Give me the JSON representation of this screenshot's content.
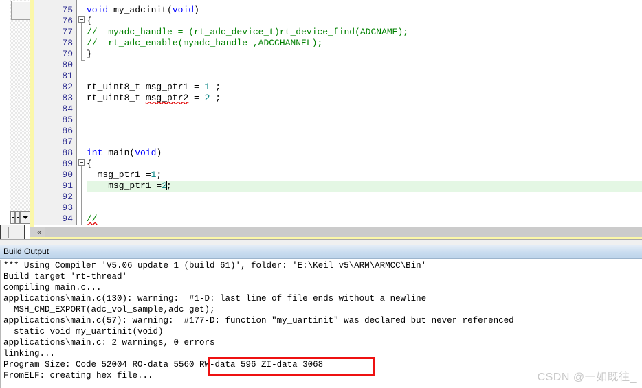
{
  "editor": {
    "scrollbar": {
      "vertical_thumb": "scroll-thumb",
      "up_dot": "·",
      "mid_dot": "·",
      "down_arrow": "▼",
      "h_left_arrow": "«"
    },
    "lines": [
      {
        "num": "75",
        "segments": [
          {
            "t": "void ",
            "c": "kw"
          },
          {
            "t": "my_adcinit(",
            "c": "plain"
          },
          {
            "t": "void",
            "c": "kw"
          },
          {
            "t": ")",
            "c": "plain"
          }
        ]
      },
      {
        "num": "76",
        "segments": [
          {
            "t": "{",
            "c": "plain"
          }
        ]
      },
      {
        "num": "77",
        "segments": [
          {
            "t": "//  myadc_handle = (rt_adc_device_t)rt_device_find(ADCNAME);",
            "c": "cmt"
          }
        ]
      },
      {
        "num": "78",
        "segments": [
          {
            "t": "//  rt_adc_enable(myadc_handle ,ADCCHANNEL);",
            "c": "cmt"
          }
        ]
      },
      {
        "num": "79",
        "segments": [
          {
            "t": "}",
            "c": "plain"
          }
        ]
      },
      {
        "num": "80",
        "segments": []
      },
      {
        "num": "81",
        "segments": []
      },
      {
        "num": "82",
        "segments": [
          {
            "t": "rt_uint8_t msg_ptr1 = ",
            "c": "plain"
          },
          {
            "t": "1",
            "c": "num"
          },
          {
            "t": " ;",
            "c": "plain"
          }
        ]
      },
      {
        "num": "83",
        "segments": [
          {
            "t": "rt_uint8_t ",
            "c": "plain"
          },
          {
            "t": "msg_ptr2",
            "c": "plain squig"
          },
          {
            "t": " = ",
            "c": "plain"
          },
          {
            "t": "2",
            "c": "num"
          },
          {
            "t": " ;",
            "c": "plain"
          }
        ]
      },
      {
        "num": "84",
        "segments": []
      },
      {
        "num": "85",
        "segments": []
      },
      {
        "num": "86",
        "segments": []
      },
      {
        "num": "87",
        "segments": []
      },
      {
        "num": "88",
        "segments": [
          {
            "t": "int ",
            "c": "kw"
          },
          {
            "t": "main(",
            "c": "plain"
          },
          {
            "t": "void",
            "c": "kw"
          },
          {
            "t": ")",
            "c": "plain"
          }
        ]
      },
      {
        "num": "89",
        "segments": [
          {
            "t": "{",
            "c": "plain"
          }
        ]
      },
      {
        "num": "90",
        "segments": [
          {
            "t": "  msg_ptr1 =",
            "c": "plain"
          },
          {
            "t": "1",
            "c": "num"
          },
          {
            "t": ";",
            "c": "plain"
          }
        ]
      },
      {
        "num": "91",
        "segments": [
          {
            "t": "    msg_ptr1 =",
            "c": "plain"
          },
          {
            "t": "2",
            "c": "num"
          },
          {
            "t": ";",
            "c": "plain"
          }
        ],
        "highlight": true,
        "caret_after": 2
      },
      {
        "num": "92",
        "segments": []
      },
      {
        "num": "93",
        "segments": []
      },
      {
        "num": "94",
        "segments": [
          {
            "t": "//",
            "c": "cmt squig"
          }
        ]
      }
    ]
  },
  "build_output": {
    "title": "Build Output",
    "lines": [
      "*** Using Compiler 'V5.06 update 1 (build 61)', folder: 'E:\\Keil_v5\\ARM\\ARMCC\\Bin'",
      "Build target 'rt-thread'",
      "compiling main.c...",
      "applications\\main.c(130): warning:  #1-D: last line of file ends without a newline",
      "  MSH_CMD_EXPORT(adc_vol_sample,adc get);",
      "applications\\main.c(57): warning:  #177-D: function \"my_uartinit\" was declared but never referenced",
      "  static void my_uartinit(void)",
      "applications\\main.c: 2 warnings, 0 errors",
      "linking...",
      "Program Size: Code=52004 RO-data=5560 RW-data=596 ZI-data=3068",
      "FromELF: creating hex file..."
    ],
    "highlight_annotation": {
      "text": "RW-data=596 ZI-data=3068",
      "color": "#ee1111"
    }
  },
  "watermark": {
    "text": "CSDN @一如既往_"
  }
}
